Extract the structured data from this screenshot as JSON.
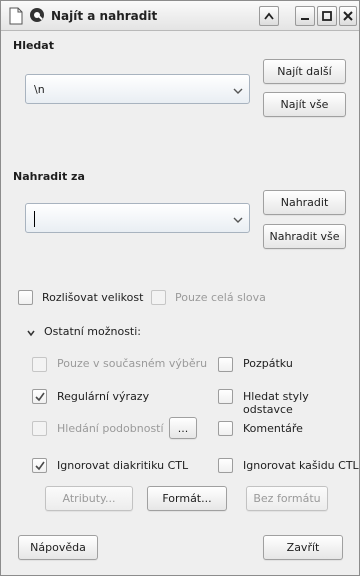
{
  "window": {
    "title": "Najít a nahradit"
  },
  "search": {
    "label": "Hledat",
    "value": "\\n",
    "find_next": "Najít další",
    "find_all": "Najít vše"
  },
  "replace": {
    "label": "Nahradit za",
    "value": "",
    "replace_btn": "Nahradit",
    "replace_all": "Nahradit vše"
  },
  "options": {
    "match_case": {
      "label": "Rozlišovat velikost",
      "checked": false,
      "enabled": true
    },
    "whole_words": {
      "label": "Pouze celá slova",
      "checked": false,
      "enabled": false
    }
  },
  "other_options": {
    "label": "Ostatní možnosti:",
    "expanded": true,
    "current_selection": {
      "label": "Pouze v současném výběru",
      "checked": false,
      "enabled": false
    },
    "backwards": {
      "label": "Pozpátku",
      "checked": false,
      "enabled": true
    },
    "regex": {
      "label": "Regulární výrazy",
      "checked": true,
      "enabled": true
    },
    "para_styles": {
      "label": "Hledat styly odstavce",
      "checked": false,
      "enabled": true
    },
    "similarity": {
      "label": "Hledání podobností",
      "checked": false,
      "enabled": false,
      "button": "..."
    },
    "comments": {
      "label": "Komentáře",
      "checked": false,
      "enabled": true
    },
    "ignore_diacritics": {
      "label": "Ignorovat diakritiku CTL",
      "checked": true,
      "enabled": true
    },
    "ignore_kashida": {
      "label": "Ignorovat kašidu CTL",
      "checked": false,
      "enabled": true
    },
    "attributes": "Atributy...",
    "format": "Formát...",
    "no_format": "Bez formátu"
  },
  "footer": {
    "help": "Nápověda",
    "close": "Zavřít"
  },
  "colors": {
    "accent": "#2a6db5",
    "checkmark": "#4a4a4a"
  }
}
